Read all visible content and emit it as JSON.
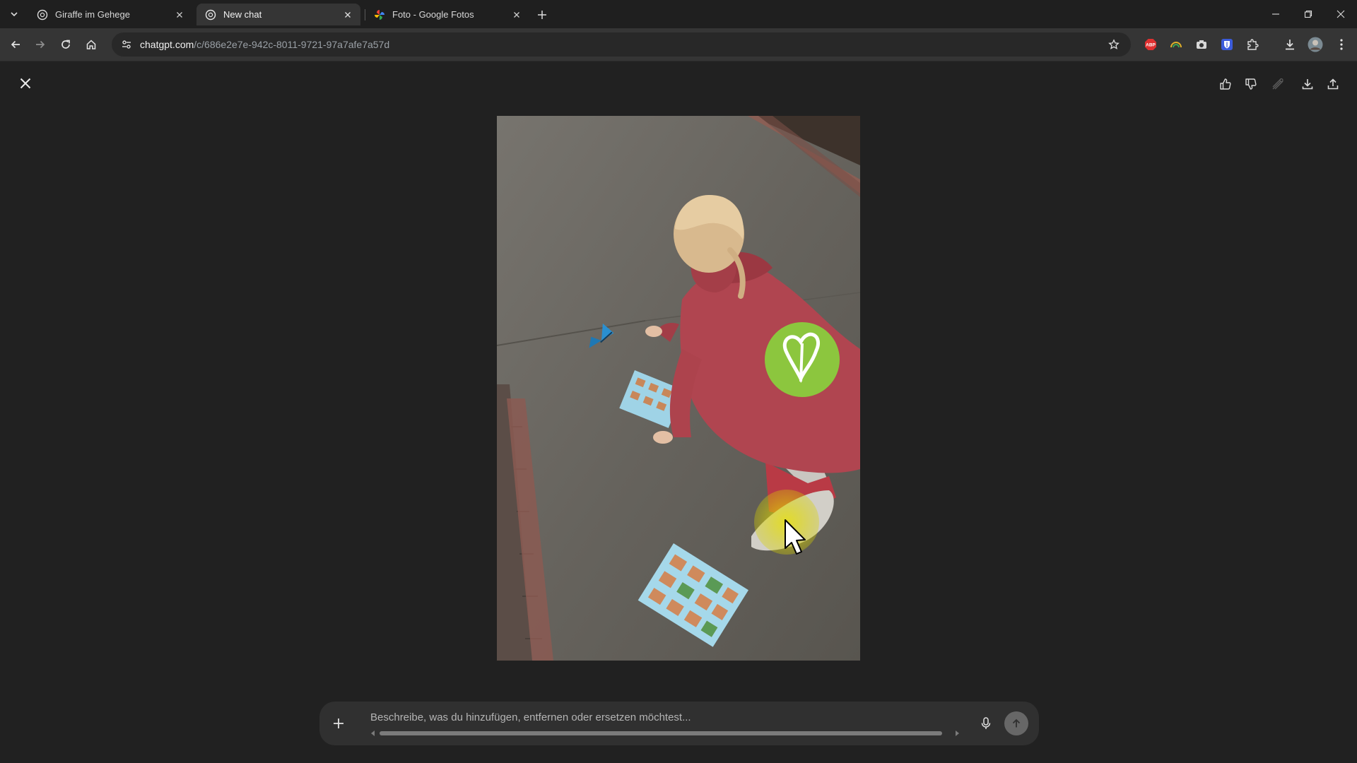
{
  "browser": {
    "tabs": [
      {
        "title": "Giraffe im Gehege",
        "favicon": "chatgpt-icon",
        "active": false
      },
      {
        "title": "New chat",
        "favicon": "chatgpt-icon",
        "active": true
      },
      {
        "title": "Foto - Google Fotos",
        "favicon": "google-photos-icon",
        "active": false
      }
    ],
    "url_host": "chatgpt.com",
    "url_path": "/c/686e2e7e-942c-8011-9721-97a7afe7a57d",
    "extensions": [
      "abp-icon",
      "rainbow-extension-icon",
      "camera-extension-icon",
      "bitwarden-shield-icon",
      "puzzle-extensions-icon",
      "download-icon",
      "profile-avatar-icon",
      "kebab-menu-icon"
    ],
    "extension_labels": {
      "abp": "ABP"
    }
  },
  "viewer": {
    "actions": [
      "thumbs-up-icon",
      "thumbs-down-icon",
      "style-icon",
      "download-icon",
      "share-icon"
    ],
    "image": {
      "subject": "photo-of-child-kneeling-on-pavement-with-butterfly-sheets"
    }
  },
  "composer": {
    "placeholder": "Beschreibe, was du hinzufügen, entfernen oder ersetzen möchtest...",
    "value": ""
  },
  "colors": {
    "page_bg": "#212121",
    "tabstrip_bg": "#1f1f1f",
    "toolbar_bg": "#353535",
    "composer_bg": "#303030",
    "abp_red": "#e03030",
    "bitwarden_blue": "#3b5bdb"
  }
}
